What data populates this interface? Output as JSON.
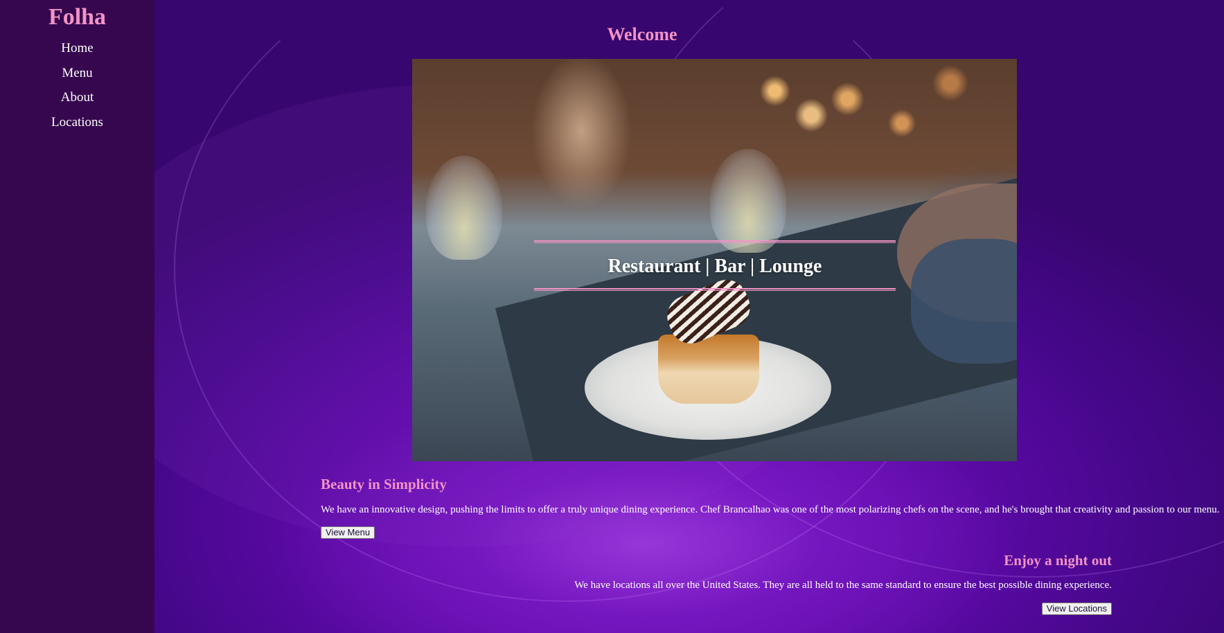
{
  "brand": "Folha",
  "nav": {
    "items": [
      {
        "label": "Home"
      },
      {
        "label": "Menu"
      },
      {
        "label": "About"
      },
      {
        "label": "Locations"
      }
    ]
  },
  "hero": {
    "heading": "Welcome",
    "banner_text": "Restaurant | Bar | Lounge"
  },
  "sections": [
    {
      "title": "Beauty in Simplicity",
      "text": "We have an innovative design, pushing the limits to offer a truly unique dining experience. Chef Brancalhao was one of the most polarizing chefs on the scene, and he's brought that creativity and passion to our menu.",
      "button": "View Menu"
    },
    {
      "title": "Enjoy a night out",
      "text": "We have locations all over the United States. They are all held to the same standard to ensure the best possible dining experience.",
      "button": "View Locations"
    }
  ],
  "colors": {
    "accent": "#f293c6",
    "sidebar": "#36074f",
    "background": "#5e0aa8",
    "text": "#ffffff"
  }
}
